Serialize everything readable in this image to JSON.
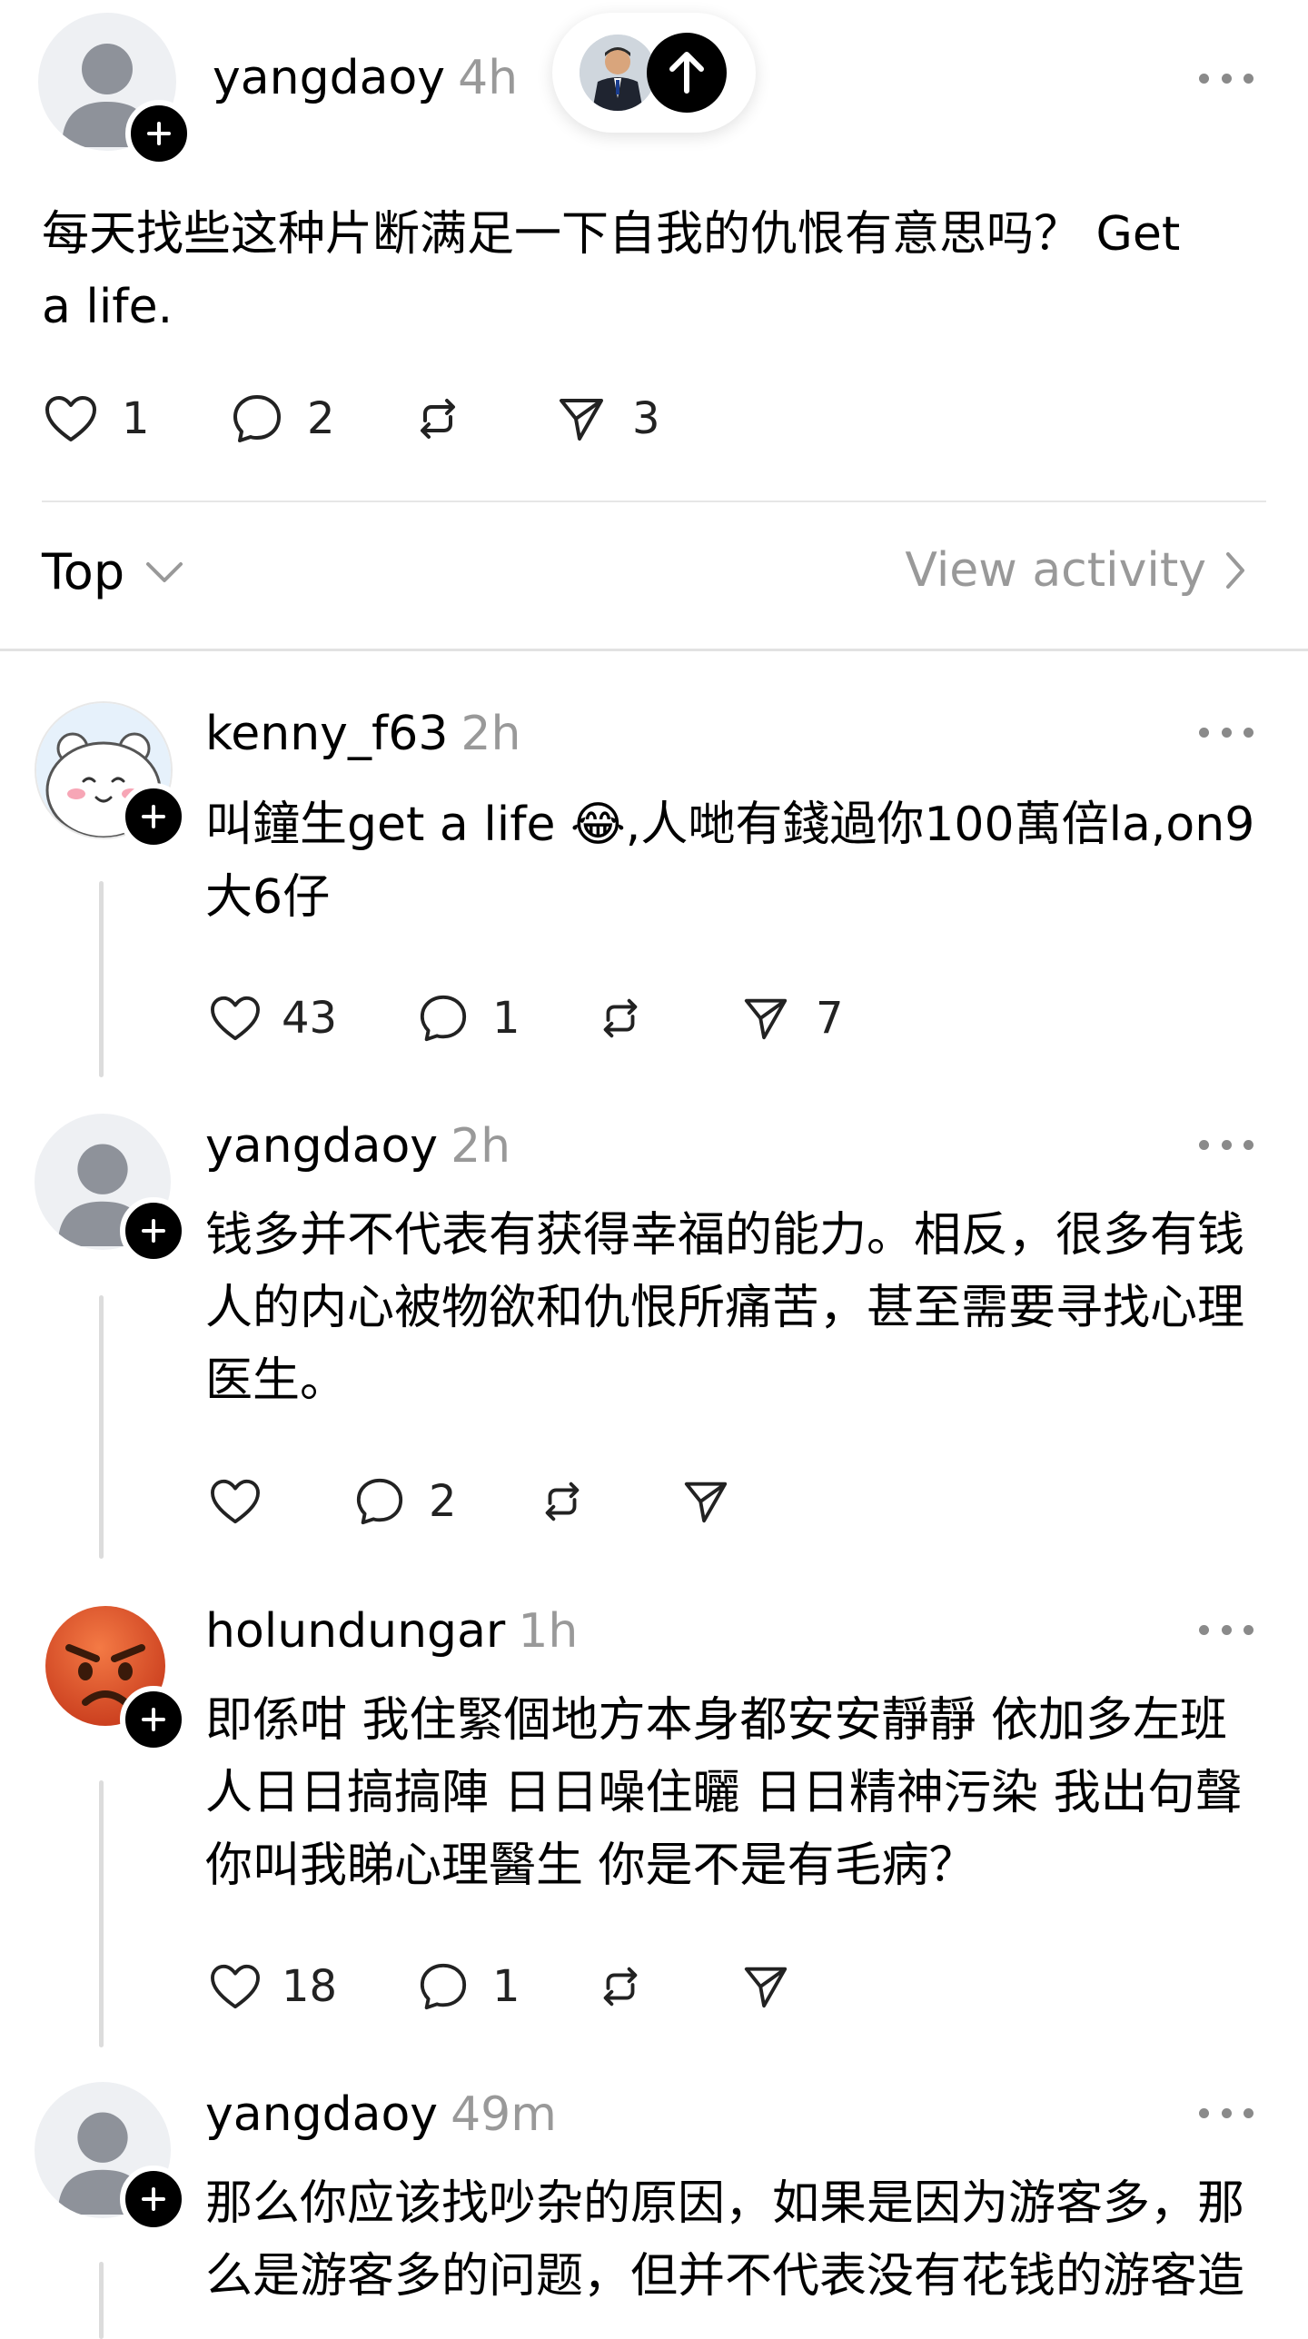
{
  "post": {
    "author": "yangdaoy",
    "time": "4h",
    "text_line1": "每天找些这种片断满足一下自我的仇恨有意思吗？ Get",
    "text_line2": "a life.",
    "likes": "1",
    "replies": "2",
    "reposts": "",
    "shares": "3"
  },
  "sort_bar": {
    "sort_label": "Top",
    "view_activity_label": "View activity"
  },
  "comments": [
    {
      "author": "kenny_f63",
      "time": "2h",
      "line1": "叫鐘生get a life 😂,人哋有錢過你100萬倍la,on9",
      "line2": "大6仔",
      "likes": "43",
      "replies": "1",
      "shares": "7",
      "avatar_icon": "cartoon-bear-icon"
    },
    {
      "author": "yangdaoy",
      "time": "2h",
      "line1": "钱多并不代表有获得幸福的能力。相反，很多有钱",
      "line2": "人的内心被物欲和仇恨所痛苦，甚至需要寻找心理",
      "line3": "医生。",
      "likes": "",
      "replies": "2",
      "shares": "",
      "avatar_icon": "default-user-icon"
    },
    {
      "author": "holundungar",
      "time": "1h",
      "line1": "即係咁 我住緊個地方本身都安安靜靜 依加多左班",
      "line2": "人日日搞搞陣 日日噪住曬 日日精神污染 我出句聲",
      "line3": "你叫我睇心理醫生 你是不是有毛病？",
      "likes": "18",
      "replies": "1",
      "shares": "",
      "avatar_icon": "angry-face-icon"
    },
    {
      "author": "yangdaoy",
      "time": "49m",
      "line1": "那么你应该找吵杂的原因，如果是因为游客多，那",
      "line2": "么是游客多的问题，但并不代表没有花钱的游客造",
      "avatar_icon": "default-user-icon"
    }
  ],
  "colors": {
    "muted": "#999999",
    "badge": "#000000",
    "angry_face": "#e8532a"
  }
}
